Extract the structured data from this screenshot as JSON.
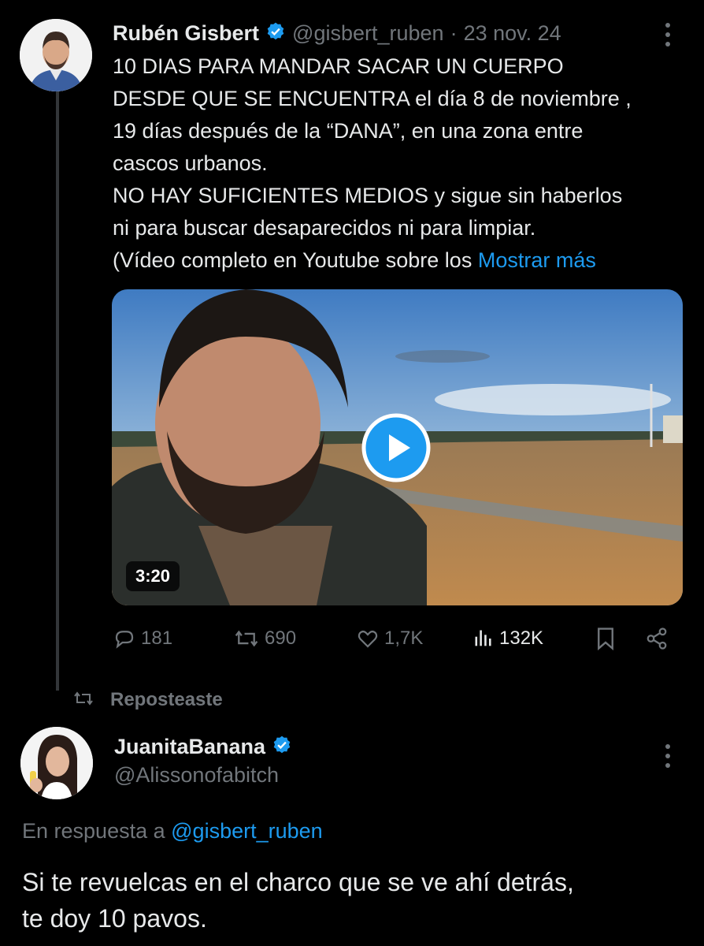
{
  "tweet": {
    "author_name": "Rubén Gisbert",
    "handle": "@gisbert_ruben",
    "separator": "·",
    "date": "23 nov. 24",
    "text_lines": [
      "10 DIAS PARA MANDAR SACAR UN CUERPO",
      "DESDE QUE SE ENCUENTRA el día 8 de noviembre ,",
      "19 días después de la “DANA”, en una zona entre",
      "cascos urbanos.",
      "NO HAY SUFICIENTES MEDIOS y sigue sin haberlos",
      "ni para buscar desaparecidos ni para limpiar.",
      "(Vídeo completo en Youtube sobre los"
    ],
    "show_more": "Mostrar más",
    "video_duration": "3:20",
    "replies": "181",
    "reposts": "690",
    "likes": "1,7K",
    "views": "132K"
  },
  "repost_label": "Reposteaste",
  "reply": {
    "author_name": "JuanitaBanana",
    "handle": "@Alissonofabitch",
    "in_reply_prefix": "En respuesta a",
    "in_reply_handle": "@gisbert_ruben",
    "text_lines": [
      "Si te revuelcas en el charco que se ve ahí detrás,",
      "te doy 10 pavos."
    ]
  },
  "colors": {
    "accent": "#1d9bf0",
    "muted": "#71767b",
    "text": "#e7e9ea",
    "background": "#000000"
  },
  "icons": [
    "more-icon",
    "verified-badge-icon",
    "play-icon",
    "reply-icon",
    "repost-icon",
    "like-icon",
    "views-icon",
    "bookmark-icon",
    "share-icon"
  ]
}
